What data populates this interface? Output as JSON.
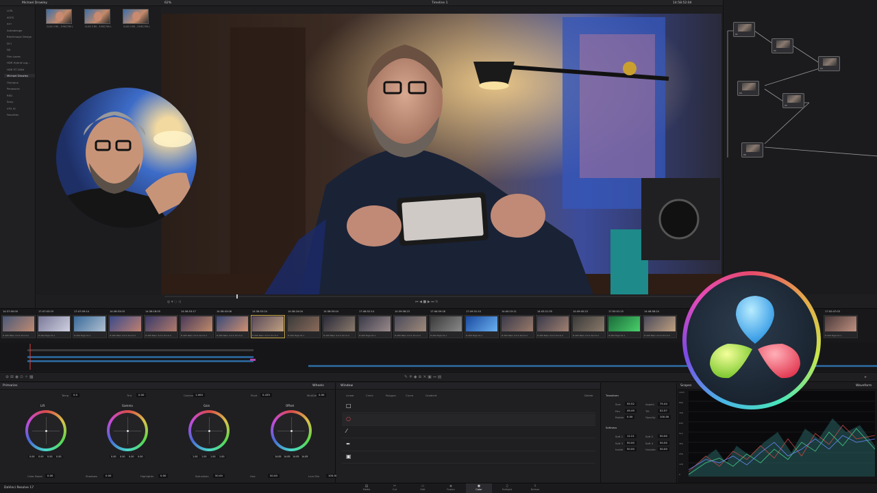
{
  "topbar": {
    "project": "Michael Drowley",
    "zoom": "62%",
    "timeline": "Timeline 1",
    "timecode": "14:58:52:04",
    "mode": "Clip"
  },
  "luts": {
    "items": [
      "LUTs",
      "ACES",
      "Arri",
      "Astrodesign",
      "Blackmagic Design",
      "DCI",
      "DJI",
      "Film Looks",
      "HDR Hybrid Log...",
      "HDR ST 2084",
      "Michael Drowley",
      "Olympus",
      "Panasonic",
      "RED",
      "Sony",
      "VFX IO",
      "Favorites"
    ],
    "selected_index": 10
  },
  "gallery": {
    "stills": [
      "CLOG 3 R5 - 3 REC709 L",
      "CLOG 3 R5 - 3 REC709 L",
      "CLOG 3 R5 - 3 REC709 L"
    ]
  },
  "nodes": [
    {
      "label": "01"
    },
    {
      "label": "02"
    },
    {
      "label": "03"
    },
    {
      "label": "04"
    },
    {
      "label": "05"
    },
    {
      "label": "06"
    }
  ],
  "clips": [
    {
      "num": "01",
      "tc": "14:37:00:00",
      "codec": "H.265 Main 4:2:2 10 L5.2"
    },
    {
      "num": "02",
      "tc": "17:47:03:19",
      "codec": "H.264 High L5.1"
    },
    {
      "num": "03",
      "tc": "17:47:09:14",
      "codec": "H.264 High L5.1"
    },
    {
      "num": "04",
      "tc": "14:36:53:03",
      "codec": "H.265 Main 4:2:2 10 L5.2"
    },
    {
      "num": "05",
      "tc": "14:38:18:05",
      "codec": "H.265 Main 4:2:2 10 L5.2"
    },
    {
      "num": "06",
      "tc": "14:36:53:17",
      "codec": "H.265 Main 4:2:2 10 L5.2"
    },
    {
      "num": "07",
      "tc": "14:38:43:08",
      "codec": "H.265 Main 4:2:2 10 L5.2"
    },
    {
      "num": "08",
      "tc": "14:38:53:24",
      "codec": "H.265 Main 4:2:2 10 L5.2"
    },
    {
      "num": "09",
      "tc": "14:38:24:04",
      "codec": "H.264 High L5.1"
    },
    {
      "num": "10",
      "tc": "14:38:55:04",
      "codec": "H.265 Main 4:2:2 10 L5.2"
    },
    {
      "num": "11",
      "tc": "17:48:52:14",
      "codec": "H.264 High L5.1"
    },
    {
      "num": "12",
      "tc": "14:39:58:23",
      "codec": "H.265 Main 4:2:2 10 L5.2"
    },
    {
      "num": "13",
      "tc": "17:46:59:18",
      "codec": "H.264 High L5.1"
    },
    {
      "num": "14",
      "tc": "17:49:31:10",
      "codec": "H.264 High L5.1"
    },
    {
      "num": "15",
      "tc": "14:40:15:11",
      "codec": "H.265 Main 4:2:2 10 L5.2"
    },
    {
      "num": "16",
      "tc": "14:43:21:35",
      "codec": "H.265 Main 4:2:2 10 L5.2"
    },
    {
      "num": "17",
      "tc": "14:49:45:23",
      "codec": "H.265 Main 4:2:2 10 L5.2"
    },
    {
      "num": "18",
      "tc": "17:50:01:15",
      "codec": "H.264 High L5.1"
    },
    {
      "num": "19",
      "tc": "14:48:58:24",
      "codec": "H.265 Main 4:2:2 10 L5.2"
    },
    {
      "num": "24",
      "tc": "17:50:47:03",
      "codec": "H.264 High L5.1"
    }
  ],
  "primaries": {
    "title": "Primaries",
    "mode": "Wheels",
    "params_top": [
      {
        "label": "Temp",
        "value": "0.0"
      },
      {
        "label": "Tint",
        "value": "0.00"
      },
      {
        "label": "Contrast",
        "value": "1.000"
      },
      {
        "label": "Pivot",
        "value": "0.435"
      },
      {
        "label": "Mid/Detail",
        "value": "0.00"
      }
    ],
    "wheels": [
      {
        "name": "Lift",
        "vals": [
          "0.00",
          "0.00",
          "0.00",
          "0.00"
        ]
      },
      {
        "name": "Gamma",
        "vals": [
          "0.00",
          "0.00",
          "0.00",
          "0.00"
        ]
      },
      {
        "name": "Gain",
        "vals": [
          "1.00",
          "1.00",
          "1.00",
          "1.00"
        ]
      },
      {
        "name": "Offset",
        "vals": [
          "14.85",
          "14.85",
          "14.85",
          "14.85"
        ]
      }
    ],
    "params_bottom": [
      {
        "label": "Color Boost",
        "value": "0.00"
      },
      {
        "label": "Shadows",
        "value": "0.00"
      },
      {
        "label": "Highlights",
        "value": "0.00"
      },
      {
        "label": "Saturation",
        "value": "50.00"
      },
      {
        "label": "Hue",
        "value": "50.00"
      },
      {
        "label": "Lum Mix",
        "value": "100.00"
      }
    ]
  },
  "window": {
    "title": "Window",
    "tools": [
      "Linear",
      "Circle",
      "Polygon",
      "Curve",
      "Gradient"
    ],
    "delete_label": "Delete"
  },
  "transform": {
    "title": "Transform",
    "rows": [
      {
        "a": "Size",
        "av": "55.52",
        "b": "Aspect",
        "bv": "75.44"
      },
      {
        "a": "Pan",
        "av": "49.49",
        "b": "Tilt",
        "bv": "52.57"
      },
      {
        "a": "Rotate",
        "av": "0.00",
        "b": "Opacity",
        "bv": "100.00"
      }
    ],
    "softness_title": "Softness",
    "softness": [
      {
        "a": "Soft 1",
        "av": "12.21",
        "b": "Soft 2",
        "bv": "50.00"
      },
      {
        "a": "Soft 3",
        "av": "50.00",
        "b": "Soft 4",
        "bv": "50.00"
      },
      {
        "a": "Inside",
        "av": "50.00",
        "b": "Outside",
        "bv": "50.00"
      }
    ]
  },
  "scopes": {
    "title": "Scopes",
    "mode": "Waveform",
    "scale": [
      "1023",
      "896",
      "768",
      "640",
      "512",
      "384",
      "256",
      "128",
      "0"
    ]
  },
  "app_name": "DaVinci Resolve 17",
  "pages": [
    {
      "icon": "▤",
      "label": "Media"
    },
    {
      "icon": "✂",
      "label": "Cut"
    },
    {
      "icon": "▭",
      "label": "Edit"
    },
    {
      "icon": "◈",
      "label": "Fusion"
    },
    {
      "icon": "◉",
      "label": "Color"
    },
    {
      "icon": "♫",
      "label": "Fairlight"
    },
    {
      "icon": "⇪",
      "label": "Deliver"
    }
  ],
  "active_page": "Color",
  "colors": {
    "accent": "#c9a64a",
    "active_page": "#e8e8e8",
    "playhead": "#e04040"
  }
}
